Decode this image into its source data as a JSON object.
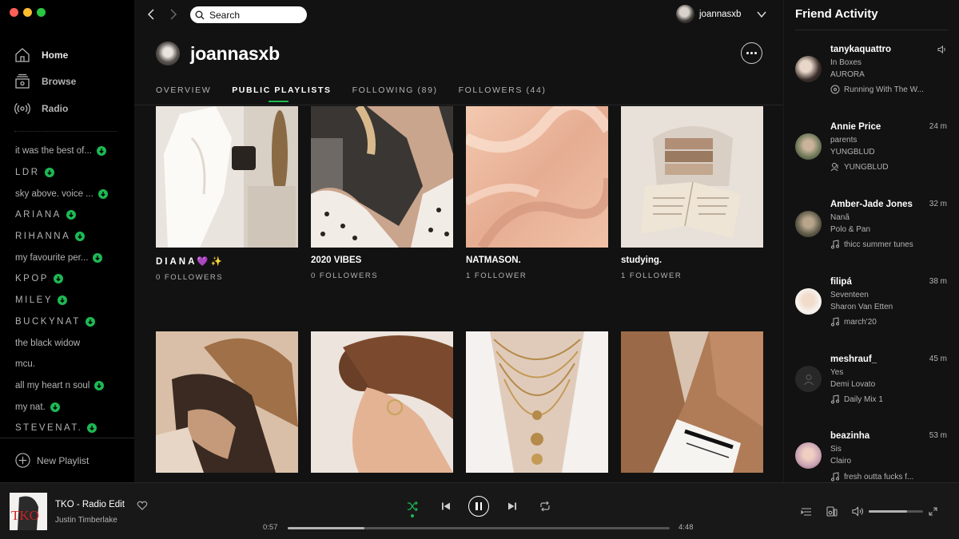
{
  "window": {
    "traffic_lights": [
      "#ff5f57",
      "#febc2e",
      "#28c840"
    ]
  },
  "colors": {
    "accent": "#1db954",
    "background": "#121212",
    "sidebar": "#000000",
    "player": "#181818"
  },
  "sidebar": {
    "nav": [
      {
        "label": "Home",
        "icon": "home-icon"
      },
      {
        "label": "Browse",
        "icon": "browse-icon"
      },
      {
        "label": "Radio",
        "icon": "radio-icon"
      }
    ],
    "playlists": [
      {
        "label": "it was the best of...",
        "downloaded": true
      },
      {
        "label": "LDR",
        "downloaded": true
      },
      {
        "label": "sky above. voice ...",
        "downloaded": true
      },
      {
        "label": "ARIANA",
        "downloaded": true
      },
      {
        "label": "RIHANNA",
        "downloaded": true
      },
      {
        "label": "my favourite per...",
        "downloaded": true
      },
      {
        "label": "KPOP",
        "downloaded": true
      },
      {
        "label": "MILEY",
        "downloaded": true
      },
      {
        "label": "BUCKYNAT",
        "downloaded": true
      },
      {
        "label": "the black widow",
        "downloaded": false
      },
      {
        "label": "mcu.",
        "downloaded": false
      },
      {
        "label": "all my heart n soul",
        "downloaded": true
      },
      {
        "label": "my nat.",
        "downloaded": true
      },
      {
        "label": "STEVENAT.",
        "downloaded": true
      }
    ],
    "new_playlist_label": "New Playlist"
  },
  "topbar": {
    "search_placeholder": "Search",
    "username": "joannasxb"
  },
  "profile": {
    "name": "joannasxb",
    "tabs": [
      {
        "label": "OVERVIEW",
        "active": false
      },
      {
        "label": "PUBLIC PLAYLISTS",
        "active": true
      },
      {
        "label": "FOLLOWING (89)",
        "active": false
      },
      {
        "label": "FOLLOWERS (44)",
        "active": false
      }
    ]
  },
  "playlists_grid": [
    {
      "title": "DIANA💜✨",
      "followers": "0 FOLLOWERS",
      "cover": "white-dress-photo"
    },
    {
      "title": "2020 VIBES",
      "followers": "0 FOLLOWERS",
      "cover": "polka-dot-portrait-photo"
    },
    {
      "title": "NATMASON.",
      "followers": "1 FOLLOWER",
      "cover": "satin-fabric-photo"
    },
    {
      "title": "studying.",
      "followers": "1 FOLLOWER",
      "cover": "books-and-bag-photo"
    },
    {
      "title": "",
      "followers": "",
      "cover": "embrace-photo"
    },
    {
      "title": "",
      "followers": "",
      "cover": "hair-bun-photo"
    },
    {
      "title": "",
      "followers": "",
      "cover": "gold-necklaces-photo"
    },
    {
      "title": "",
      "followers": "",
      "cover": "corduroy-jacket-photo"
    }
  ],
  "friend_activity": {
    "title": "Friend Activity",
    "friends": [
      {
        "name": "tanykaquattro",
        "time": "",
        "live": true,
        "track": "In Boxes",
        "artist": "AURORA",
        "context": "Running With The W...",
        "context_icon": "album-icon"
      },
      {
        "name": "Annie Price",
        "time": "24 m",
        "live": false,
        "track": "parents",
        "artist": "YUNGBLUD",
        "context": "YUNGBLUD",
        "context_icon": "artist-icon"
      },
      {
        "name": "Amber-Jade Jones",
        "time": "32 m",
        "live": false,
        "track": "Nanã",
        "artist": "Polo & Pan",
        "context": "thicc summer tunes",
        "context_icon": "playlist-icon"
      },
      {
        "name": "filipá",
        "time": "38 m",
        "live": false,
        "track": "Seventeen",
        "artist": "Sharon Van Etten",
        "context": "march'20",
        "context_icon": "playlist-icon"
      },
      {
        "name": "meshrauf_",
        "time": "45 m",
        "live": false,
        "track": "Yes",
        "artist": "Demi Lovato",
        "context": "Daily Mix 1",
        "context_icon": "playlist-icon"
      },
      {
        "name": "beazinha",
        "time": "53 m",
        "live": false,
        "track": "Sis",
        "artist": "Clairo",
        "context": "fresh outta fucks f...",
        "context_icon": "playlist-icon"
      }
    ]
  },
  "player": {
    "track": "TKO - Radio Edit",
    "artist": "Justin Timberlake",
    "album_art_text": "TKO",
    "elapsed": "0:57",
    "duration": "4:48",
    "progress": 0.2,
    "volume": 0.7,
    "shuffle": true,
    "playing": true
  }
}
